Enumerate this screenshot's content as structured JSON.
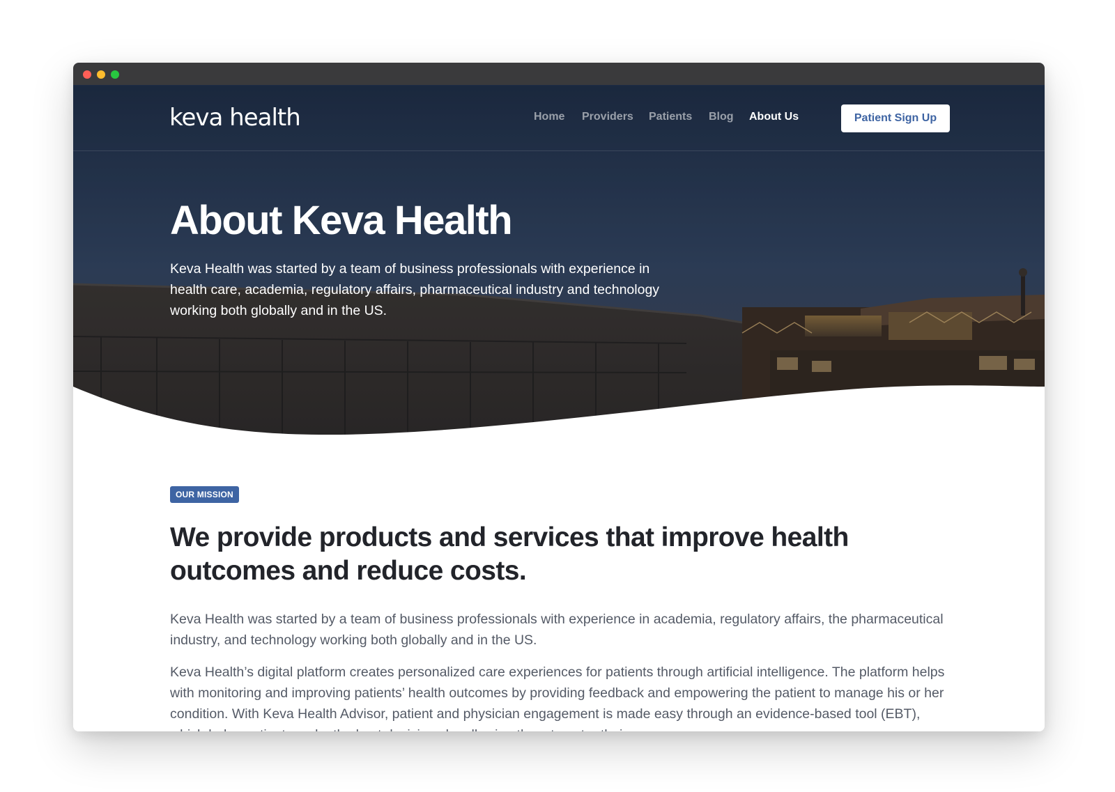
{
  "nav": {
    "logo": "keva health",
    "links": [
      {
        "label": "Home",
        "active": false
      },
      {
        "label": "Providers",
        "active": false
      },
      {
        "label": "Patients",
        "active": false
      },
      {
        "label": "Blog",
        "active": false
      },
      {
        "label": "About Us",
        "active": true
      }
    ],
    "cta_label": "Patient Sign Up"
  },
  "hero": {
    "title": "About Keva Health",
    "text": "Keva Health was started by a team of business professionals with experience in health care, academia, regulatory affairs, pharmaceutical industry and technology working both globally and in the US."
  },
  "mission": {
    "badge": "OUR MISSION",
    "heading": "We provide products and services that improve health outcomes and reduce costs.",
    "paragraphs": [
      "Keva Health was started by a team of business professionals with experience in academia, regulatory affairs, the pharmaceutical industry, and technology working both globally and in the US.",
      "Keva Health’s digital platform creates personalized care experiences for patients through artificial intelligence. The platform helps with monitoring and improving patients’ health outcomes by providing feedback and empowering the patient to manage his or her condition. With Keva Health Advisor, patient and physician engagement is made easy through an evidence-based tool (EBT), which helps patients make the best decisions by allowing them to enter their"
    ]
  },
  "colors": {
    "accent": "#3e64a3",
    "heading": "#22242a",
    "body_text": "#545a66",
    "hero_dark": "#1f2d44"
  }
}
